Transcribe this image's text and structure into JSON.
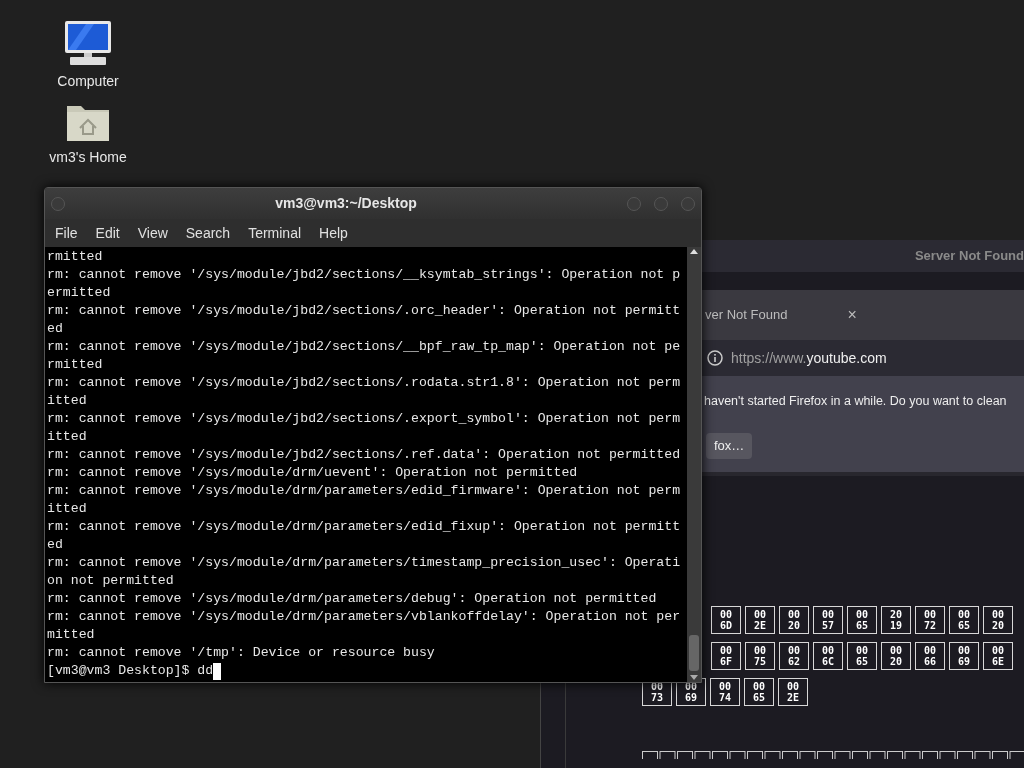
{
  "desktop_icons": [
    {
      "label": "Computer",
      "kind": "computer"
    },
    {
      "label": "vm3's Home",
      "kind": "home"
    }
  ],
  "terminal": {
    "title": "vm3@vm3:~/Desktop",
    "menu": [
      "File",
      "Edit",
      "View",
      "Search",
      "Terminal",
      "Help"
    ],
    "lines": [
      "rmitted",
      "rm: cannot remove '/sys/module/jbd2/sections/__ksymtab_strings': Operation not p",
      "ermitted",
      "rm: cannot remove '/sys/module/jbd2/sections/.orc_header': Operation not permitt",
      "ed",
      "rm: cannot remove '/sys/module/jbd2/sections/__bpf_raw_tp_map': Operation not pe",
      "rmitted",
      "rm: cannot remove '/sys/module/jbd2/sections/.rodata.str1.8': Operation not perm",
      "itted",
      "rm: cannot remove '/sys/module/jbd2/sections/.export_symbol': Operation not perm",
      "itted",
      "rm: cannot remove '/sys/module/jbd2/sections/.ref.data': Operation not permitted",
      "rm: cannot remove '/sys/module/drm/uevent': Operation not permitted",
      "rm: cannot remove '/sys/module/drm/parameters/edid_firmware': Operation not perm",
      "itted",
      "rm: cannot remove '/sys/module/drm/parameters/edid_fixup': Operation not permitt",
      "ed",
      "rm: cannot remove '/sys/module/drm/parameters/timestamp_precision_usec': Operati",
      "on not permitted",
      "rm: cannot remove '/sys/module/drm/parameters/debug': Operation not permitted",
      "rm: cannot remove '/sys/module/drm/parameters/vblankoffdelay': Operation not per",
      "mitted",
      "rm: cannot remove '/tmp': Device or resource busy"
    ],
    "prompt": "[vm3@vm3 Desktop]$ dd"
  },
  "browser": {
    "title": "Server Not Found",
    "tab": {
      "label": "ver Not Found",
      "close": "×"
    },
    "url": {
      "prefix": "https://www.",
      "domain": "youtube.com"
    },
    "notice": {
      "message": "haven't started Firefox in a while. Do you want to clean",
      "button": "fox…"
    },
    "glyph_rows": [
      [
        [
          "00",
          "6D"
        ],
        [
          "00",
          "2E"
        ],
        [
          "00",
          "20"
        ],
        [
          "00",
          "57"
        ],
        [
          "00",
          "65"
        ],
        [
          "20",
          "19"
        ],
        [
          "00",
          "72"
        ],
        [
          "00",
          "65"
        ],
        [
          "00",
          "20"
        ]
      ],
      [
        [
          "00",
          "6F"
        ],
        [
          "00",
          "75"
        ],
        [
          "00",
          "62"
        ],
        [
          "00",
          "6C"
        ],
        [
          "00",
          "65"
        ],
        [
          "00",
          "20"
        ],
        [
          "00",
          "66"
        ],
        [
          "00",
          "69"
        ],
        [
          "00",
          "6E"
        ]
      ],
      [
        [
          "00",
          "73"
        ],
        [
          "00",
          "69"
        ],
        [
          "00",
          "74"
        ],
        [
          "00",
          "65"
        ],
        [
          "00",
          "2E"
        ]
      ]
    ]
  }
}
